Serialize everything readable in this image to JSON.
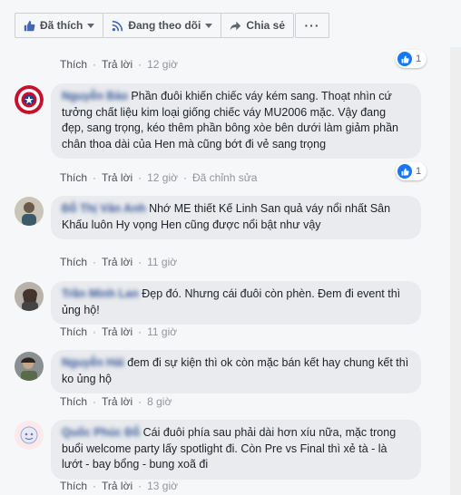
{
  "toolbar": {
    "like_label": "Đã thích",
    "follow_label": "Đang theo dõi",
    "share_label": "Chia sẻ",
    "more_label": "···"
  },
  "meta_labels": {
    "like": "Thích",
    "reply": "Trả lời",
    "edited": "Đã chỉnh sửa"
  },
  "comments": [
    {
      "time": "12 giờ",
      "likes": "1"
    },
    {
      "author": "Nguyễn Bảo",
      "text": "Phần đuôi khiến chiếc váy kém sang. Thoạt nhìn cứ tưởng chất liệu kim loại giống chiếc váy MU2006 mặc. Vậy đang đẹp, sang trọng, kéo thêm phần bông xòe bên dưới làm giảm phần chân thoa dài của Hen mà cũng bớt đi vẻ sang trọng",
      "time": "12 giờ",
      "likes": "1",
      "edited": true
    },
    {
      "author": "Đỗ Thị Vân Anh",
      "text": "Nhớ ME thiết Kế Linh San quả váy nổi nhất Sân Khấu luôn Hy vọng Hen cũng được nổi bật như vậy",
      "time": "11 giờ"
    },
    {
      "author": "Trần Minh Lan",
      "text": "Đẹp đó. Nhưng cái đuôi còn phèn. Đem đi event thì ủng hộ!",
      "time": "11 giờ"
    },
    {
      "author": "Nguyễn Hải",
      "text": "đem đi sự kiện thì ok còn mặc bán kết hay chung kết thì ko ủng hộ",
      "time": "8 giờ"
    },
    {
      "author": "Quốc Phúc Đỗ",
      "text": "Cái đuôi phía sau phải dài hơn xíu nữa, mặc trong buổi welcome party lấy spotlight đi. Còn Pre vs Final thì xẻ tà - là lướt - bay bổng - bung xoã đi",
      "time": "13 giờ"
    }
  ]
}
